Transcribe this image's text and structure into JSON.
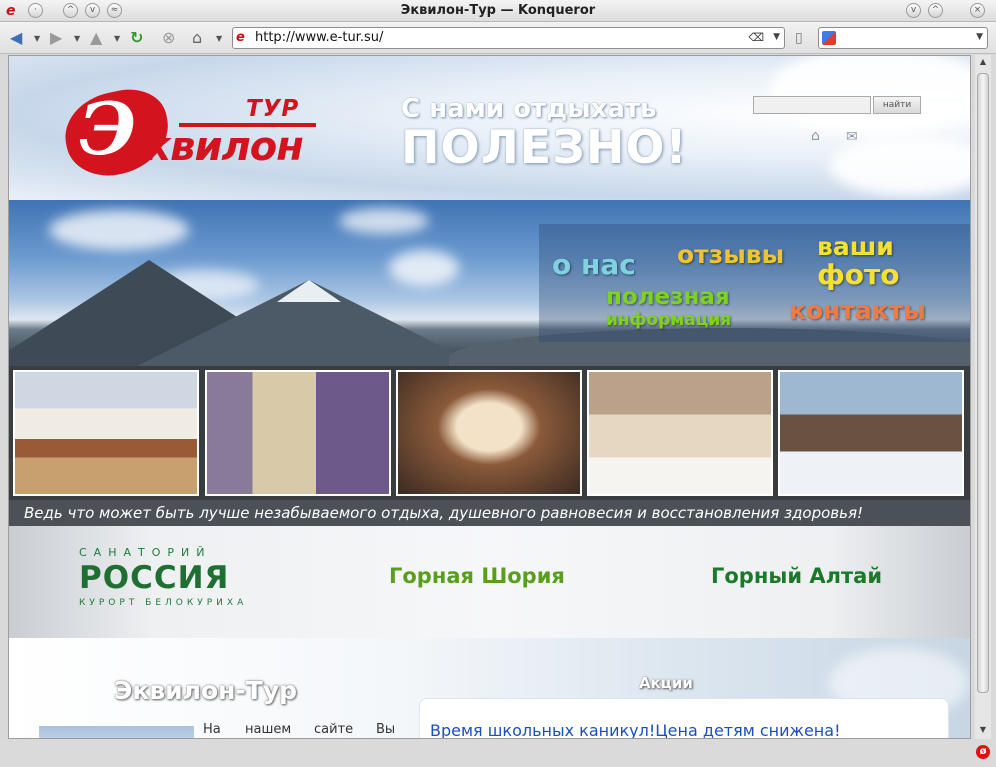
{
  "window": {
    "title": "Эквилон-Тур — Konqueror"
  },
  "toolbar": {
    "url": "http://www.e-tur.su/"
  },
  "site": {
    "logo_tur": "ТУР",
    "logo_name": "квилон",
    "slogan_line1": "С нами отдыхать",
    "slogan_line2": "ПОЛЕЗНО!",
    "search_button": "найти",
    "nav": {
      "about": "о нас",
      "reviews": "отзывы",
      "photos_line1": "ваши",
      "photos_line2": "фото",
      "info_line1": "полезная",
      "info_line2": "информация",
      "contacts": "контакты"
    },
    "caption": "Ведь что может быть лучше незабываемого отдыха, душевного равновесия и восстановления здоровья!",
    "partners": {
      "sanatorium_small": "САНАТОРИЙ",
      "sanatorium_name": "РОССИЯ",
      "sanatorium_sub": "КУРОРТ БЕЛОКУРИХА",
      "gornaya_shoria": "Горная Шория",
      "gorny_altai": "Горный Алтай"
    },
    "company_title": "Эквилон-Тур",
    "intro_words": [
      "На",
      "нашем",
      "сайте",
      "Вы"
    ],
    "promo_title": "Акции",
    "promo_link": "Время школьных каникул!Цена детям снижена!"
  },
  "colors": {
    "brand_red": "#d3141e",
    "nav_about": "#7fd3e0",
    "nav_reviews": "#f1c232",
    "nav_photos": "#f6e22a",
    "nav_info": "#7ed321",
    "nav_contacts": "#ef7a45",
    "shoria_green": "#5a9e1e",
    "altai_green": "#1a7a2a",
    "link_blue": "#1a4fc2"
  }
}
